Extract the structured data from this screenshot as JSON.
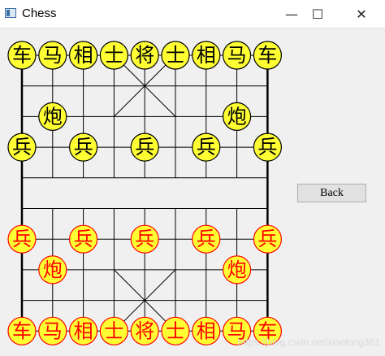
{
  "window": {
    "title": "Chess",
    "minimize_glyph": "—",
    "maximize_glyph": "☐",
    "close_glyph": "✕"
  },
  "controls": {
    "back_label": "Back"
  },
  "watermark": "https://blog.csdn.net/xiaolong361",
  "colors": {
    "piece_fill": "#ffff33",
    "black_side_text": "#000000",
    "red_side_text": "#ff0000",
    "board_line": "#000000"
  },
  "board": {
    "files": 9,
    "ranks": 10,
    "pieces": [
      {
        "side": "black",
        "char": "车",
        "file": 0,
        "rank": 0
      },
      {
        "side": "black",
        "char": "马",
        "file": 1,
        "rank": 0
      },
      {
        "side": "black",
        "char": "相",
        "file": 2,
        "rank": 0
      },
      {
        "side": "black",
        "char": "士",
        "file": 3,
        "rank": 0
      },
      {
        "side": "black",
        "char": "将",
        "file": 4,
        "rank": 0
      },
      {
        "side": "black",
        "char": "士",
        "file": 5,
        "rank": 0
      },
      {
        "side": "black",
        "char": "相",
        "file": 6,
        "rank": 0
      },
      {
        "side": "black",
        "char": "马",
        "file": 7,
        "rank": 0
      },
      {
        "side": "black",
        "char": "车",
        "file": 8,
        "rank": 0
      },
      {
        "side": "black",
        "char": "炮",
        "file": 1,
        "rank": 2
      },
      {
        "side": "black",
        "char": "炮",
        "file": 7,
        "rank": 2
      },
      {
        "side": "black",
        "char": "兵",
        "file": 0,
        "rank": 3
      },
      {
        "side": "black",
        "char": "兵",
        "file": 2,
        "rank": 3
      },
      {
        "side": "black",
        "char": "兵",
        "file": 4,
        "rank": 3
      },
      {
        "side": "black",
        "char": "兵",
        "file": 6,
        "rank": 3
      },
      {
        "side": "black",
        "char": "兵",
        "file": 8,
        "rank": 3
      },
      {
        "side": "red",
        "char": "兵",
        "file": 0,
        "rank": 6
      },
      {
        "side": "red",
        "char": "兵",
        "file": 2,
        "rank": 6
      },
      {
        "side": "red",
        "char": "兵",
        "file": 4,
        "rank": 6
      },
      {
        "side": "red",
        "char": "兵",
        "file": 6,
        "rank": 6
      },
      {
        "side": "red",
        "char": "兵",
        "file": 8,
        "rank": 6
      },
      {
        "side": "red",
        "char": "炮",
        "file": 1,
        "rank": 7
      },
      {
        "side": "red",
        "char": "炮",
        "file": 7,
        "rank": 7
      },
      {
        "side": "red",
        "char": "车",
        "file": 0,
        "rank": 9
      },
      {
        "side": "red",
        "char": "马",
        "file": 1,
        "rank": 9
      },
      {
        "side": "red",
        "char": "相",
        "file": 2,
        "rank": 9
      },
      {
        "side": "red",
        "char": "士",
        "file": 3,
        "rank": 9
      },
      {
        "side": "red",
        "char": "将",
        "file": 4,
        "rank": 9
      },
      {
        "side": "red",
        "char": "士",
        "file": 5,
        "rank": 9
      },
      {
        "side": "red",
        "char": "相",
        "file": 6,
        "rank": 9
      },
      {
        "side": "red",
        "char": "马",
        "file": 7,
        "rank": 9
      },
      {
        "side": "red",
        "char": "车",
        "file": 8,
        "rank": 9
      }
    ]
  }
}
